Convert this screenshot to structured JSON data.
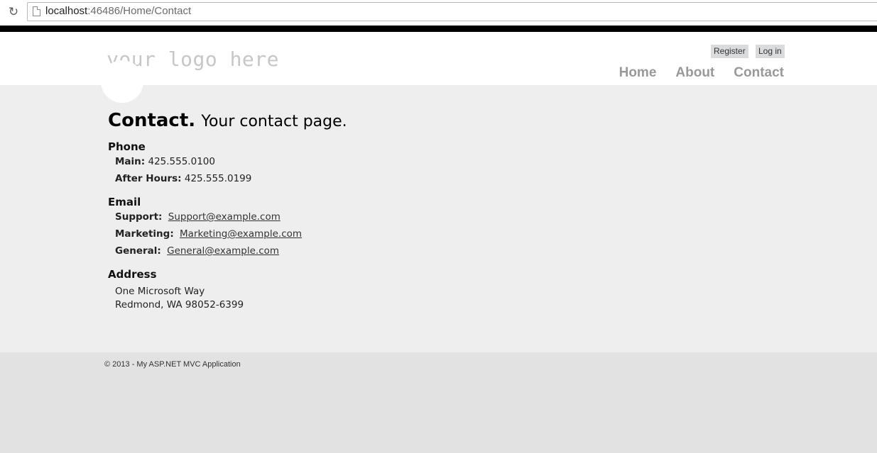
{
  "browser": {
    "url_host": "localhost",
    "url_rest": ":46486/Home/Contact"
  },
  "header": {
    "logo_text": "your logo here",
    "register_label": "Register",
    "login_label": "Log in",
    "nav": [
      "Home",
      "About",
      "Contact"
    ]
  },
  "main": {
    "title": "Contact.",
    "subtitle": "Your contact page.",
    "phone": {
      "heading": "Phone",
      "main_label": "Main:",
      "main_value": "425.555.0100",
      "after_label": "After Hours:",
      "after_value": "425.555.0199"
    },
    "email": {
      "heading": "Email",
      "support_label": "Support:",
      "support_value": "Support@example.com",
      "marketing_label": "Marketing:",
      "marketing_value": "Marketing@example.com",
      "general_label": "General:",
      "general_value": "General@example.com"
    },
    "address": {
      "heading": "Address",
      "line1": "One Microsoft Way",
      "line2": "Redmond, WA 98052-6399"
    }
  },
  "footer": {
    "copyright": "© 2013 - My ASP.NET MVC Application"
  }
}
